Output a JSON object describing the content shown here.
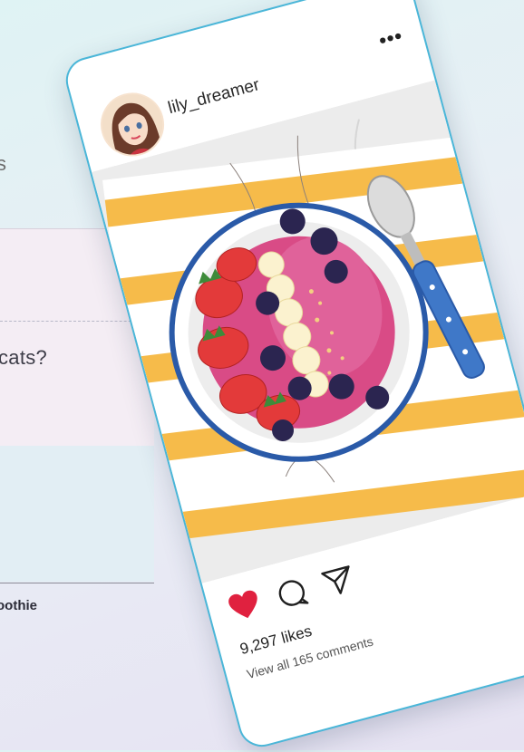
{
  "background": {
    "fragment_s": "s",
    "fragment_cats": "cats?",
    "fragment_smoothie": "oothie"
  },
  "post": {
    "username": "lily_dreamer",
    "more_label": "•••",
    "likes": "9,297 likes",
    "comments_link": "View all 165 comments"
  },
  "colors": {
    "card_border": "#4ab6d8",
    "like_heart": "#e0213f",
    "stripe": "#f6bb4a",
    "bowl_rim": "#2a5aa8",
    "spoon_handle": "#3f78c8"
  },
  "icons": {
    "like": "heart-icon",
    "comment": "comment-bubble-icon",
    "share": "send-icon",
    "more": "more-dots-icon"
  }
}
